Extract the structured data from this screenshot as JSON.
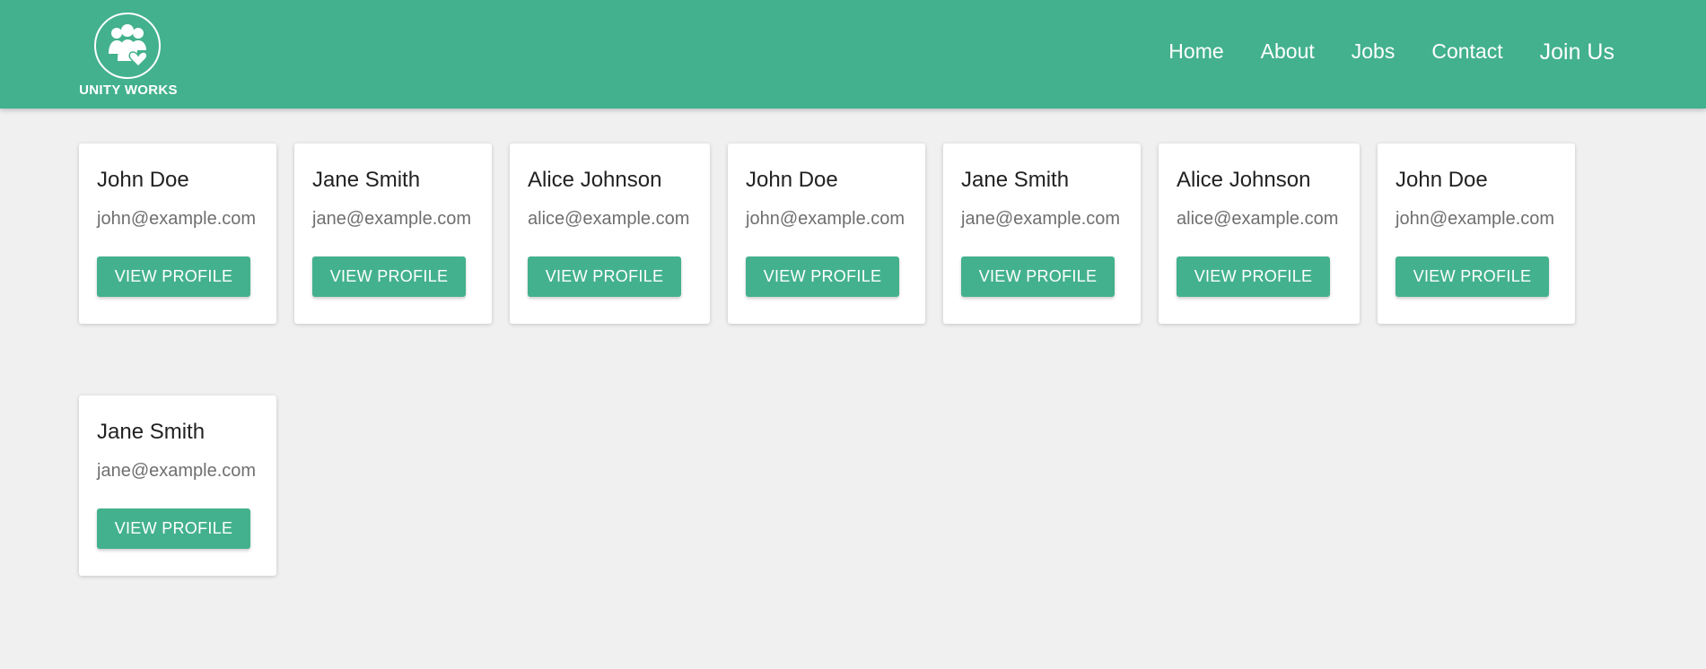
{
  "brand": {
    "name": "UNITY WORKS",
    "logo_icon": "people-heart-icon"
  },
  "nav": {
    "home": "Home",
    "about": "About",
    "jobs": "Jobs",
    "contact": "Contact",
    "join": "Join Us"
  },
  "cards": [
    {
      "name": "John Doe",
      "email": "john@example.com",
      "button": "VIEW PROFILE"
    },
    {
      "name": "Jane Smith",
      "email": "jane@example.com",
      "button": "VIEW PROFILE"
    },
    {
      "name": "Alice Johnson",
      "email": "alice@example.com",
      "button": "VIEW PROFILE"
    },
    {
      "name": "John Doe",
      "email": "john@example.com",
      "button": "VIEW PROFILE"
    },
    {
      "name": "Jane Smith",
      "email": "jane@example.com",
      "button": "VIEW PROFILE"
    },
    {
      "name": "Alice Johnson",
      "email": "alice@example.com",
      "button": "VIEW PROFILE"
    },
    {
      "name": "John Doe",
      "email": "john@example.com",
      "button": "VIEW PROFILE"
    },
    {
      "name": "Jane Smith",
      "email": "jane@example.com",
      "button": "VIEW PROFILE"
    }
  ],
  "colors": {
    "brand_green": "#43b18d",
    "page_background": "#f0f0f0",
    "card_background": "#ffffff"
  }
}
